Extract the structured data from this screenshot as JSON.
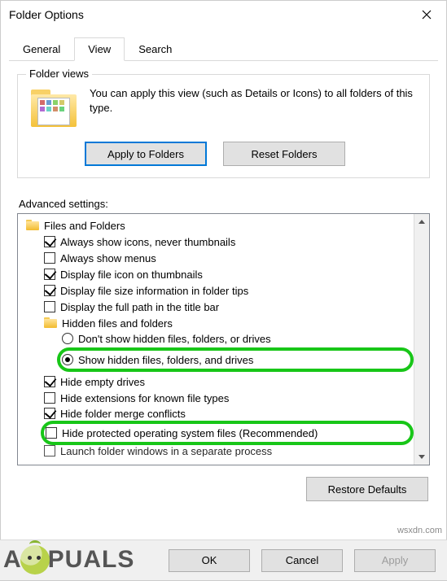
{
  "title": "Folder Options",
  "tabs": {
    "general": "General",
    "view": "View",
    "search": "Search"
  },
  "folderViews": {
    "title": "Folder views",
    "text": "You can apply this view (such as Details or Icons) to all folders of this type.",
    "applyBtn": "Apply to Folders",
    "resetBtn": "Reset Folders"
  },
  "advancedLabel": "Advanced settings:",
  "tree": {
    "root": "Files and Folders",
    "item1": "Always show icons, never thumbnails",
    "item2": "Always show menus",
    "item3": "Display file icon on thumbnails",
    "item4": "Display file size information in folder tips",
    "item5": "Display the full path in the title bar",
    "hiddenGroup": "Hidden files and folders",
    "radio1": "Don't show hidden files, folders, or drives",
    "radio2": "Show hidden files, folders, and drives",
    "item6": "Hide empty drives",
    "item7": "Hide extensions for known file types",
    "item8": "Hide folder merge conflicts",
    "item9": "Hide protected operating system files (Recommended)",
    "item10": "Launch folder windows in a separate process"
  },
  "restoreBtn": "Restore Defaults",
  "footer": {
    "ok": "OK",
    "cancel": "Cancel",
    "apply": "Apply"
  },
  "watermark": {
    "p1": "A",
    "p2": "PUALS"
  },
  "credit": "wsxdn.com",
  "colors": {
    "highlight": "#18c618",
    "btnFocus": "#0078d7"
  },
  "cells": [
    "#d36a6a",
    "#6a9bd3",
    "#8ad36a",
    "#d3ca6a",
    "#b06ad3",
    "#6ad3c6",
    "#d38f6a",
    "#6ad37e"
  ]
}
